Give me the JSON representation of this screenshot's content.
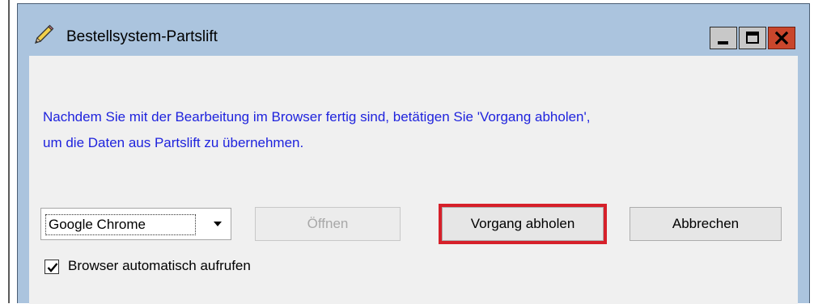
{
  "window": {
    "title": "Bestellsystem-Partslift",
    "icon": "pencil-icon",
    "controls": [
      "minimize-icon",
      "maximize-icon",
      "close-icon"
    ]
  },
  "message": {
    "line1": "Nachdem Sie mit der Bearbeitung im Browser fertig sind, betätigen Sie 'Vorgang abholen',",
    "line2": "um die Daten aus Partslift zu übernehmen.",
    "color": "#1f23dd"
  },
  "browser_select": {
    "value": "Google Chrome"
  },
  "buttons": {
    "open": "Öffnen",
    "fetch": "Vorgang abholen",
    "cancel": "Abbrechen"
  },
  "checkbox": {
    "label": "Browser automatisch aufrufen",
    "checked": true
  },
  "colors": {
    "titlebar": "#abc4de",
    "highlight": "#d6202a",
    "close": "#c9462c"
  }
}
